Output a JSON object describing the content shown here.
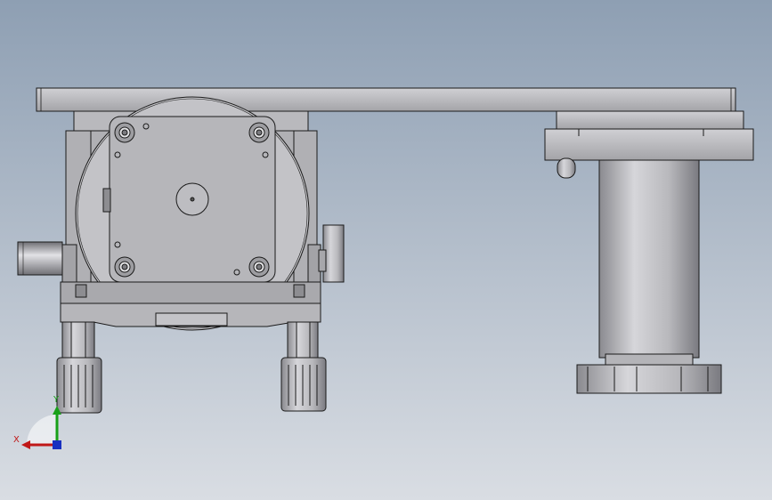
{
  "viewport": {
    "background_top": "#8e9fb3",
    "background_bottom": "#d9dde3"
  },
  "colors": {
    "part_light": "#c4c4c8",
    "part_mid": "#a9a9ad",
    "part_dark": "#7d7d82",
    "outline": "#1a1a1a",
    "motor_face": "#b3b3b7"
  },
  "triad": {
    "x_label": "X",
    "y_label": "Y",
    "x_color": "#c01818",
    "y_color": "#18a018",
    "z_color": "#1830c0"
  }
}
